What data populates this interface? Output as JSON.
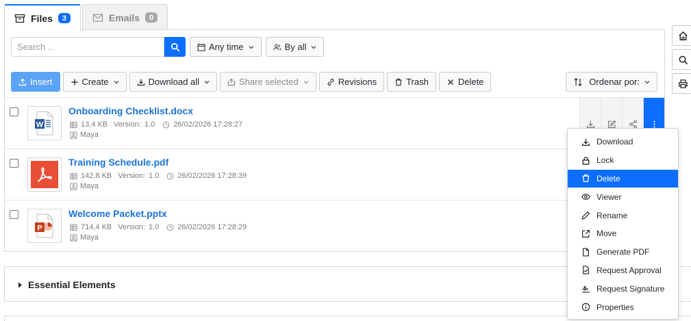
{
  "tabs": [
    {
      "label": "Files",
      "count": "3",
      "icon": "archive-icon"
    },
    {
      "label": "Emails",
      "count": "0",
      "icon": "envelope-icon"
    }
  ],
  "search": {
    "placeholder": "Search ...",
    "value": ""
  },
  "filters": {
    "time_label": "Any time",
    "user_label": "By all"
  },
  "toolbar": {
    "insert": "Insert",
    "create": "Create",
    "download_all": "Download all",
    "share_selected": "Share selected",
    "revisions": "Revisions",
    "trash": "Trash",
    "delete": "Delete",
    "sort": "Ordenar por:"
  },
  "files": [
    {
      "name": "Onboarding Checklist.docx",
      "size": "13,4 KB",
      "version_label": "Version:",
      "version": "1.0",
      "date": "26/02/2026 17:28:27",
      "owner": "Maya",
      "type": "word"
    },
    {
      "name": "Training Schedule.pdf",
      "size": "142,8 KB",
      "version_label": "Version:",
      "version": "1.0",
      "date": "26/02/2026 17:28:39",
      "owner": "Maya",
      "type": "pdf"
    },
    {
      "name": "Welcome Packet.pptx",
      "size": "714,4 KB",
      "version_label": "Version:",
      "version": "1.0",
      "date": "26/02/2026 17:28:29",
      "owner": "Maya",
      "type": "powerpoint"
    }
  ],
  "section": {
    "title": "Essential Elements"
  },
  "context_menu": {
    "items": [
      {
        "label": "Download",
        "icon": "download-icon"
      },
      {
        "label": "Lock",
        "icon": "lock-icon"
      },
      {
        "label": "Delete",
        "icon": "trash-icon",
        "active": true
      },
      {
        "label": "Viewer",
        "icon": "eye-icon"
      },
      {
        "label": "Rename",
        "icon": "pencil-icon"
      },
      {
        "label": "Move",
        "icon": "external-link-icon"
      },
      {
        "label": "Generate PDF",
        "icon": "file-icon"
      },
      {
        "label": "Request Approval",
        "icon": "file-check-icon"
      },
      {
        "label": "Request Signature",
        "icon": "signature-icon"
      },
      {
        "label": "Properties",
        "icon": "info-icon"
      }
    ]
  },
  "colors": {
    "primary": "#0d6efd",
    "link": "#1a73d9",
    "pdf_red": "#e94f37",
    "word_blue": "#2b579a",
    "ppt_orange": "#c43e1c"
  }
}
